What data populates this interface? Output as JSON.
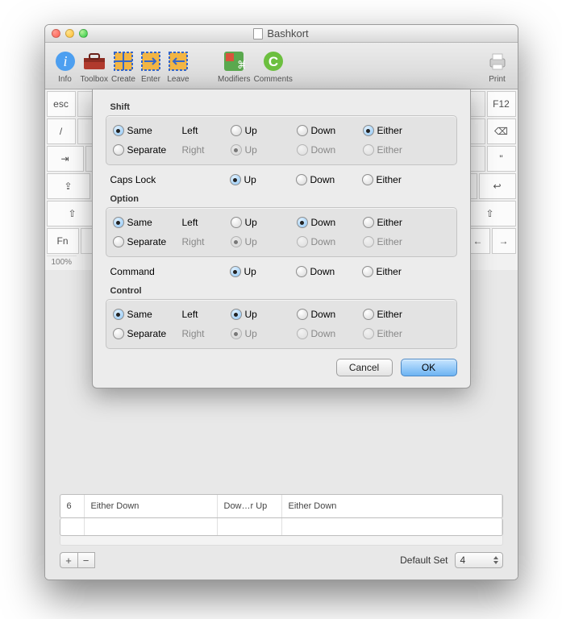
{
  "window": {
    "title": "Bashkort"
  },
  "toolbar": {
    "items": [
      {
        "name": "info",
        "label": "Info"
      },
      {
        "name": "toolbox",
        "label": "Toolbox"
      },
      {
        "name": "create",
        "label": "Create"
      },
      {
        "name": "enter",
        "label": "Enter"
      },
      {
        "name": "leave",
        "label": "Leave"
      },
      {
        "name": "modifiers",
        "label": "Modifiers"
      },
      {
        "name": "comments",
        "label": "Comments"
      },
      {
        "name": "print",
        "label": "Print"
      }
    ]
  },
  "keyboard": {
    "zoom": "100%",
    "esc": "esc",
    "slash": "/",
    "fn": "Fn",
    "quote": "\"",
    "f12": "F12"
  },
  "dialog": {
    "sections": {
      "shift": "Shift",
      "capslock": "Caps Lock",
      "option": "Option",
      "command": "Command",
      "control": "Control"
    },
    "cols": {
      "same": "Same",
      "separate": "Separate",
      "left": "Left",
      "right": "Right",
      "up": "Up",
      "down": "Down",
      "either": "Either"
    },
    "buttons": {
      "cancel": "Cancel",
      "ok": "OK"
    }
  },
  "lower": {
    "row_num": "6",
    "row_c1": "Either Down",
    "row_c2": "Dow…r Up",
    "row_c3": "Either Down",
    "add": "+",
    "remove": "−",
    "default_set_label": "Default Set",
    "default_set_value": "4"
  }
}
